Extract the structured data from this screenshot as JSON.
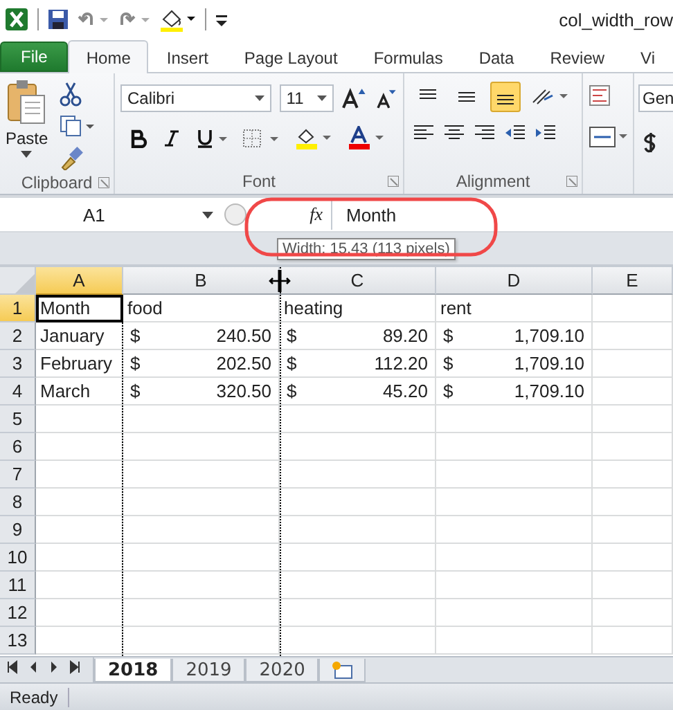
{
  "window": {
    "title": "col_width_row"
  },
  "tabs": [
    {
      "label": "File",
      "kind": "file",
      "selected": false
    },
    {
      "label": "Home",
      "kind": "tab",
      "selected": true
    },
    {
      "label": "Insert",
      "kind": "tab",
      "selected": false
    },
    {
      "label": "Page Layout",
      "kind": "tab",
      "selected": false
    },
    {
      "label": "Formulas",
      "kind": "tab",
      "selected": false
    },
    {
      "label": "Data",
      "kind": "tab",
      "selected": false
    },
    {
      "label": "Review",
      "kind": "tab",
      "selected": false
    },
    {
      "label": "Vi",
      "kind": "tab",
      "selected": false
    }
  ],
  "ribbon": {
    "paste_label": "Paste",
    "font_name": "Calibri",
    "font_size": "11",
    "number_format": "Gen",
    "vertical_align": [
      {
        "selected": false
      },
      {
        "selected": false
      },
      {
        "selected": true
      }
    ],
    "groups": [
      {
        "label": "Clipboard"
      },
      {
        "label": "Font"
      },
      {
        "label": "Alignment"
      }
    ]
  },
  "formula_bar": {
    "name_box": "A1",
    "fx": "fx",
    "content": "Month"
  },
  "tooltip": "Width: 15.43 (113 pixels)",
  "columns": [
    {
      "label": "A",
      "selected": true
    },
    {
      "label": "B",
      "selected": false
    },
    {
      "label": "C",
      "selected": false
    },
    {
      "label": "D",
      "selected": false
    },
    {
      "label": "E",
      "selected": false
    }
  ],
  "rows": [
    {
      "number": "1",
      "selected": true,
      "cells": [
        {
          "kind": "text",
          "value": "Month"
        },
        {
          "kind": "text",
          "value": "food"
        },
        {
          "kind": "text",
          "value": "heating"
        },
        {
          "kind": "text",
          "value": "rent"
        }
      ]
    },
    {
      "number": "2",
      "selected": false,
      "cells": [
        {
          "kind": "text",
          "value": "January"
        },
        {
          "kind": "currency",
          "symbol": "$",
          "value": "240.50"
        },
        {
          "kind": "currency",
          "symbol": "$",
          "value": "89.20"
        },
        {
          "kind": "currency",
          "symbol": "$",
          "value": "1,709.10"
        }
      ]
    },
    {
      "number": "3",
      "selected": false,
      "cells": [
        {
          "kind": "text",
          "value": "February"
        },
        {
          "kind": "currency",
          "symbol": "$",
          "value": "202.50"
        },
        {
          "kind": "currency",
          "symbol": "$",
          "value": "112.20"
        },
        {
          "kind": "currency",
          "symbol": "$",
          "value": "1,709.10"
        }
      ]
    },
    {
      "number": "4",
      "selected": false,
      "cells": [
        {
          "kind": "text",
          "value": "March"
        },
        {
          "kind": "currency",
          "symbol": "$",
          "value": "320.50"
        },
        {
          "kind": "currency",
          "symbol": "$",
          "value": "45.20"
        },
        {
          "kind": "currency",
          "symbol": "$",
          "value": "1,709.10"
        }
      ]
    },
    {
      "number": "5",
      "selected": false,
      "cells": []
    },
    {
      "number": "6",
      "selected": false,
      "cells": []
    },
    {
      "number": "7",
      "selected": false,
      "cells": []
    },
    {
      "number": "8",
      "selected": false,
      "cells": []
    },
    {
      "number": "9",
      "selected": false,
      "cells": []
    },
    {
      "number": "10",
      "selected": false,
      "cells": []
    },
    {
      "number": "11",
      "selected": false,
      "cells": []
    },
    {
      "number": "12",
      "selected": false,
      "cells": []
    },
    {
      "number": "13",
      "selected": false,
      "cells": []
    }
  ],
  "sheets": [
    {
      "label": "2018",
      "selected": true
    },
    {
      "label": "2019",
      "selected": false
    },
    {
      "label": "2020",
      "selected": false
    }
  ],
  "status_bar": {
    "text": "Ready"
  }
}
